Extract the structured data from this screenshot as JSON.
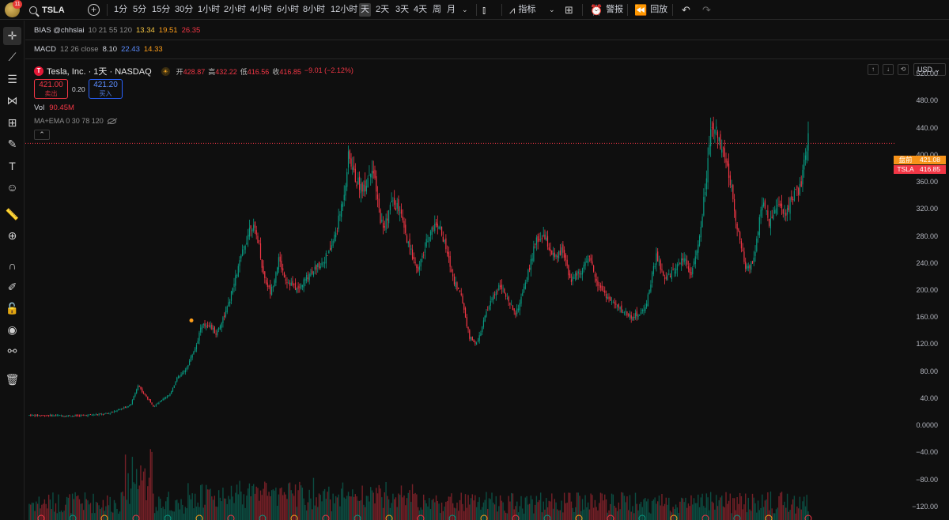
{
  "header": {
    "avatar_badge": "11",
    "symbol": "TSLA",
    "timeframes": [
      "1分",
      "5分",
      "15分",
      "30分",
      "1小时",
      "2小时",
      "4小时",
      "6小时",
      "8小时",
      "12小时",
      "天",
      "2天",
      "3天",
      "4天",
      "周",
      "月"
    ],
    "active_timeframe": "天",
    "indicators_label": "指标",
    "alerts_label": "警报",
    "replay_label": "回放"
  },
  "panes": {
    "bias": {
      "name": "BIAS @chhslai",
      "params": "10 21 55 120",
      "v1": "13.34",
      "v2": "19.51",
      "v3": "26.35",
      "c1": "#f5c542",
      "c2": "#ff9f1a",
      "c3": "#f23645"
    },
    "macd": {
      "name": "MACD",
      "params": "12 26 close",
      "v1": "8.10",
      "v2": "22.43",
      "v3": "14.33",
      "c1": "#d1d4dc",
      "c2": "#2962ff",
      "c3": "#ff9f1a"
    }
  },
  "legend": {
    "title": "Tesla, Inc. · 1天 · NASDAQ",
    "open_label": "开",
    "open": "428.87",
    "high_label": "高",
    "high": "432.22",
    "low_label": "低",
    "low": "416.56",
    "close_label": "收",
    "close": "416.85",
    "change": "−9.01 (−2.12%)",
    "sell_price": "421.00",
    "sell_label": "卖出",
    "spread": "0.20",
    "buy_price": "421.20",
    "buy_label": "买入",
    "vol_label": "Vol",
    "vol_value": "90.45M",
    "ma_label": "MA+EMA 0 30 78 120",
    "currency": "USD"
  },
  "price_scale": {
    "ticks": [
      "520.00",
      "480.00",
      "440.00",
      "400.00",
      "360.00",
      "320.00",
      "280.00",
      "240.00",
      "200.00",
      "160.00",
      "120.00",
      "80.00",
      "40.00",
      "0.0000",
      "−40.00",
      "−80.00",
      "−120.00"
    ],
    "premarket_label": "盘前",
    "premarket_price": "421.08",
    "current_label": "TSLA",
    "current_price": "416.85"
  },
  "colors": {
    "up": "#089981",
    "down": "#f23645",
    "bg": "#0f0f0f",
    "accent": "#2962ff"
  },
  "chart_data": {
    "type": "candlestick",
    "title": "Tesla, Inc. · 1天 · NASDAQ",
    "ylim": [
      -140,
      540
    ],
    "trend": [
      [
        0,
        15
      ],
      [
        0.06,
        14
      ],
      [
        0.1,
        17
      ],
      [
        0.13,
        30
      ],
      [
        0.14,
        60
      ],
      [
        0.145,
        50
      ],
      [
        0.16,
        28
      ],
      [
        0.18,
        45
      ],
      [
        0.19,
        70
      ],
      [
        0.2,
        80
      ],
      [
        0.215,
        120
      ],
      [
        0.22,
        145
      ],
      [
        0.23,
        150
      ],
      [
        0.24,
        135
      ],
      [
        0.255,
        175
      ],
      [
        0.27,
        240
      ],
      [
        0.285,
        300
      ],
      [
        0.295,
        270
      ],
      [
        0.3,
        225
      ],
      [
        0.31,
        195
      ],
      [
        0.32,
        245
      ],
      [
        0.33,
        215
      ],
      [
        0.345,
        200
      ],
      [
        0.36,
        225
      ],
      [
        0.375,
        240
      ],
      [
        0.385,
        255
      ],
      [
        0.395,
        290
      ],
      [
        0.405,
        350
      ],
      [
        0.41,
        400
      ],
      [
        0.42,
        360
      ],
      [
        0.43,
        350
      ],
      [
        0.44,
        385
      ],
      [
        0.45,
        310
      ],
      [
        0.455,
        290
      ],
      [
        0.465,
        330
      ],
      [
        0.475,
        320
      ],
      [
        0.485,
        270
      ],
      [
        0.5,
        230
      ],
      [
        0.515,
        290
      ],
      [
        0.525,
        300
      ],
      [
        0.535,
        260
      ],
      [
        0.545,
        215
      ],
      [
        0.555,
        190
      ],
      [
        0.565,
        130
      ],
      [
        0.575,
        120
      ],
      [
        0.585,
        160
      ],
      [
        0.595,
        190
      ],
      [
        0.605,
        210
      ],
      [
        0.615,
        180
      ],
      [
        0.625,
        165
      ],
      [
        0.635,
        200
      ],
      [
        0.65,
        270
      ],
      [
        0.66,
        280
      ],
      [
        0.675,
        245
      ],
      [
        0.685,
        260
      ],
      [
        0.695,
        215
      ],
      [
        0.705,
        225
      ],
      [
        0.72,
        245
      ],
      [
        0.73,
        210
      ],
      [
        0.745,
        185
      ],
      [
        0.76,
        170
      ],
      [
        0.775,
        160
      ],
      [
        0.79,
        170
      ],
      [
        0.805,
        250
      ],
      [
        0.815,
        215
      ],
      [
        0.825,
        225
      ],
      [
        0.84,
        250
      ],
      [
        0.85,
        225
      ],
      [
        0.86,
        270
      ],
      [
        0.87,
        375
      ],
      [
        0.875,
        430
      ],
      [
        0.88,
        440
      ],
      [
        0.89,
        410
      ],
      [
        0.9,
        360
      ],
      [
        0.91,
        285
      ],
      [
        0.92,
        230
      ],
      [
        0.93,
        245
      ],
      [
        0.94,
        330
      ],
      [
        0.95,
        300
      ],
      [
        0.96,
        325
      ],
      [
        0.97,
        310
      ],
      [
        0.98,
        340
      ],
      [
        0.99,
        350
      ],
      [
        1.0,
        425
      ]
    ]
  }
}
